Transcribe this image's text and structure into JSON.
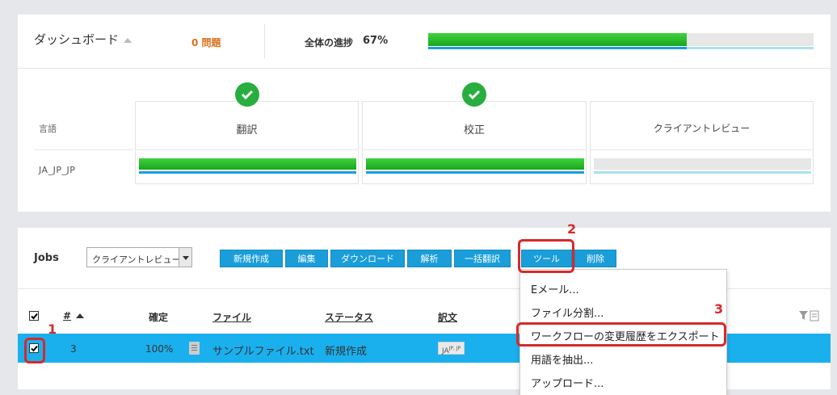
{
  "dashboard": {
    "title": "ダッシュボード",
    "issues": "0 問題",
    "progress_label": "全体の進捗",
    "progress_value": "67%",
    "progress_fraction": 0.67,
    "language_header": "言語",
    "language": "JA_JP_JP",
    "steps": [
      {
        "name": "翻訳",
        "complete": true,
        "progress_fraction": 1.0
      },
      {
        "name": "校正",
        "complete": true,
        "progress_fraction": 1.0
      },
      {
        "name": "クライアントレビュー",
        "complete": false,
        "progress_fraction": 0.0
      }
    ]
  },
  "jobs": {
    "title": "Jobs",
    "filter_select": "クライアントレビュー",
    "toolbar": [
      "新規作成",
      "編集",
      "ダウンロード",
      "解析",
      "一括翻訳",
      "ツール",
      "削除"
    ],
    "columns": {
      "number": "#",
      "confirmed": "確定",
      "file": "ファイル",
      "status": "ステータス",
      "target": "訳文"
    },
    "rows": [
      {
        "checked": true,
        "number": "3",
        "confirmed": "100%",
        "file": "サンプルファイル.txt",
        "status": "新規作成",
        "target_badge": "JA",
        "target_sup": "JP, JP"
      }
    ]
  },
  "tools_menu": [
    "Eメール...",
    "ファイル分割...",
    "ワークフローの変更履歴をエクスポート",
    "用語を抽出...",
    "アップロード..."
  ],
  "annotations": [
    "1",
    "2",
    "3"
  ],
  "colors": {
    "accent_blue": "#1a9ed9",
    "row_selected": "#1ab0ee",
    "progress_green": "#27ae3f",
    "issues_orange": "#d9711a",
    "annotation_red": "#d62a2a"
  }
}
